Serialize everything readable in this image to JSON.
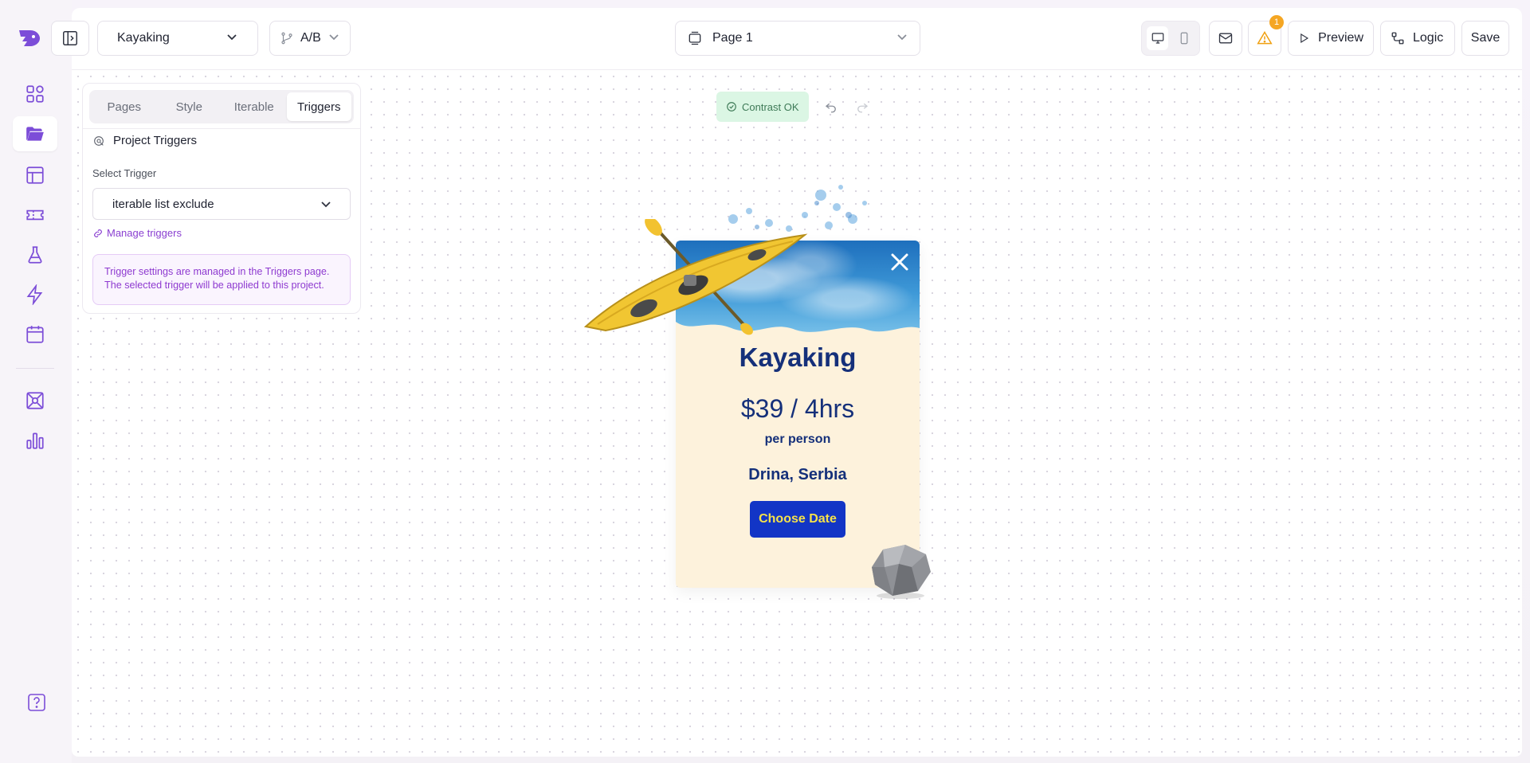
{
  "project": {
    "name": "Kayaking"
  },
  "ab": {
    "label": "A/B"
  },
  "page_select": {
    "label": "Page 1"
  },
  "header": {
    "warning_count": "1",
    "preview_label": "Preview",
    "logic_label": "Logic",
    "save_label": "Save"
  },
  "panel": {
    "tabs": [
      {
        "label": "Pages"
      },
      {
        "label": "Style"
      },
      {
        "label": "Iterable"
      },
      {
        "label": "Triggers"
      }
    ],
    "section_title": "Project Triggers",
    "select_label": "Select Trigger",
    "select_value": "iterable list exclude",
    "manage_link": "Manage triggers",
    "note_line1": "Trigger settings are managed in the Triggers page.",
    "note_line2": "The selected trigger will be applied to this project."
  },
  "canvas": {
    "contrast_label": "Contrast OK"
  },
  "popup": {
    "title": "Kayaking",
    "price": "$39 / 4hrs",
    "per": "per person",
    "location": "Drina, Serbia",
    "cta": "Choose Date"
  },
  "colors": {
    "accent": "#7c4dd8",
    "popup_bg": "#fdf2dc",
    "popup_text": "#15307a",
    "cta_bg": "#1235c6",
    "cta_text": "#f5e24a",
    "contrast_bg": "#dbf6e4"
  }
}
